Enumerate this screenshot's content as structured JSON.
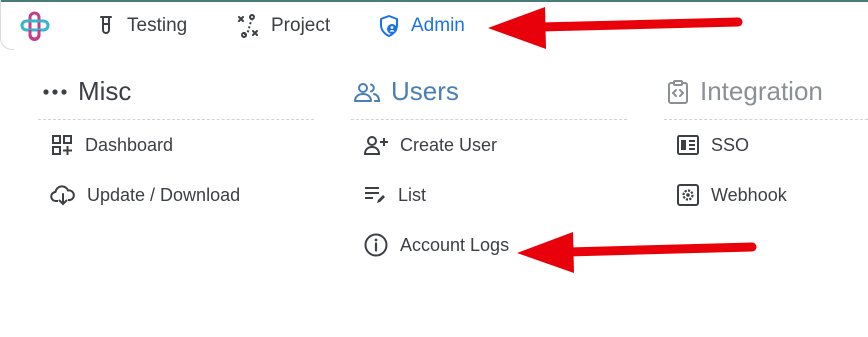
{
  "nav": {
    "items": [
      {
        "label": "Testing",
        "icon": "test-tube-icon"
      },
      {
        "label": "Project",
        "icon": "project-flow-icon"
      },
      {
        "label": "Admin",
        "icon": "shield-user-icon",
        "active": true
      }
    ]
  },
  "columns": [
    {
      "title": "Misc",
      "icon": "more-dots-icon",
      "links": [
        {
          "label": "Dashboard",
          "icon": "dashboard-grid-icon"
        },
        {
          "label": "Update / Download",
          "icon": "cloud-download-icon"
        }
      ]
    },
    {
      "title": "Users",
      "icon": "users-icon",
      "links": [
        {
          "label": "Create User",
          "icon": "user-plus-icon"
        },
        {
          "label": "List",
          "icon": "list-edit-icon"
        },
        {
          "label": "Account Logs",
          "icon": "info-circle-icon"
        }
      ]
    },
    {
      "title": "Integration",
      "icon": "clipboard-code-icon",
      "links": [
        {
          "label": "SSO",
          "icon": "sso-panel-icon"
        },
        {
          "label": "Webhook",
          "icon": "webhook-gear-icon"
        }
      ]
    }
  ],
  "colors": {
    "accent": "#1a73e8",
    "annotation_arrow": "#e8000b",
    "users_heading": "#4a7fb5",
    "integration_heading": "#8a9094"
  }
}
